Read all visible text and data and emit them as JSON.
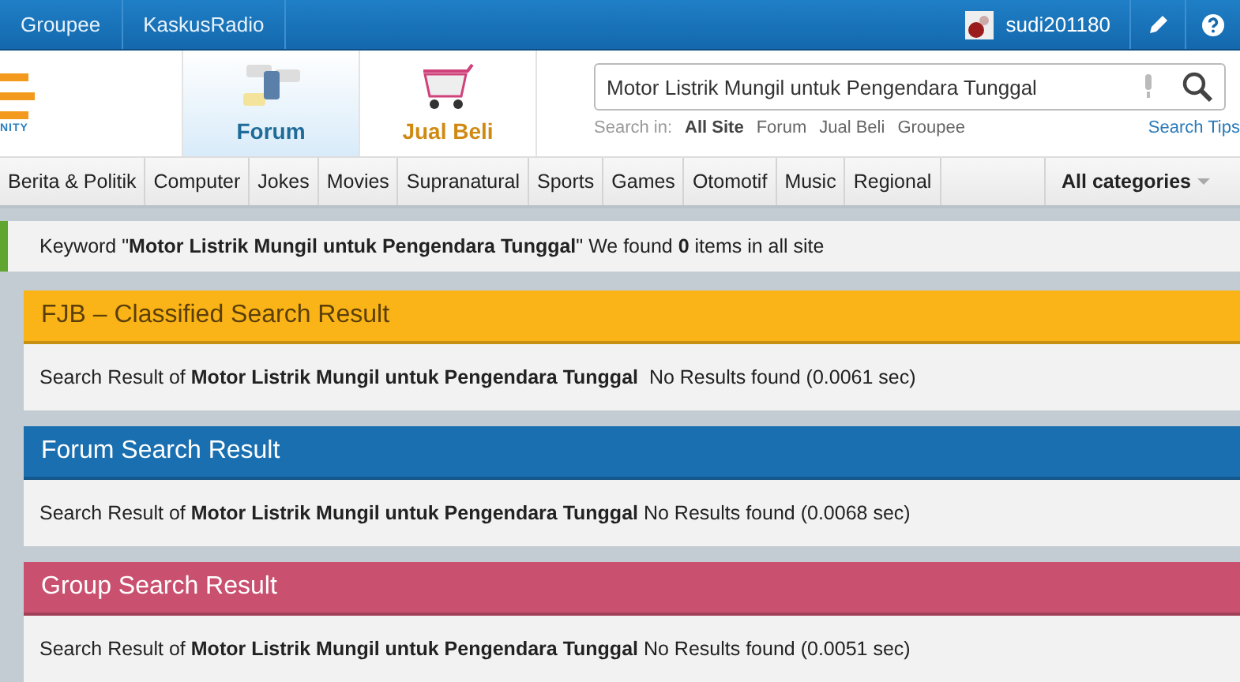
{
  "top_bar": {
    "links": [
      "Groupee",
      "KaskusRadio"
    ],
    "username": "sudi201180"
  },
  "header": {
    "logo_text": "NITY",
    "nav": [
      {
        "label": "Forum",
        "kind": "forum",
        "selected": true
      },
      {
        "label": "Jual Beli",
        "kind": "jualbeli",
        "selected": false
      }
    ],
    "search": {
      "value": "Motor Listrik Mungil untuk Pengendara Tunggal",
      "scope_label": "Search in:",
      "scopes": [
        {
          "label": "All Site",
          "selected": true
        },
        {
          "label": "Forum",
          "selected": false
        },
        {
          "label": "Jual Beli",
          "selected": false
        },
        {
          "label": "Groupee",
          "selected": false
        }
      ],
      "tips": "Search Tips"
    }
  },
  "categories": [
    "Berita & Politik",
    "Computer",
    "Jokes",
    "Movies",
    "Supranatural",
    "Sports",
    "Games",
    "Otomotif",
    "Music",
    "Regional"
  ],
  "all_categories": "All categories",
  "keyword_summary": "Keyword \"**Motor Listrik Mungil untuk Pengendara Tunggal**\" We found **0** items in all site",
  "results": [
    {
      "kind": "fjb",
      "title": "FJB – Classified Search Result",
      "color": "#fbb417",
      "text": "Search Result of **Motor Listrik Mungil untuk Pengendara Tunggal**  No Results found (0.0061 sec)"
    },
    {
      "kind": "forum",
      "title": "Forum Search Result",
      "color": "#1a6fb0",
      "text": "Search Result of **Motor Listrik Mungil untuk Pengendara Tunggal** No Results found (0.0068 sec)"
    },
    {
      "kind": "group",
      "title": "Group Search Result",
      "color": "#c9506e",
      "text": "Search Result of **Motor Listrik Mungil untuk Pengendara Tunggal** No Results found (0.0051 sec)"
    }
  ]
}
